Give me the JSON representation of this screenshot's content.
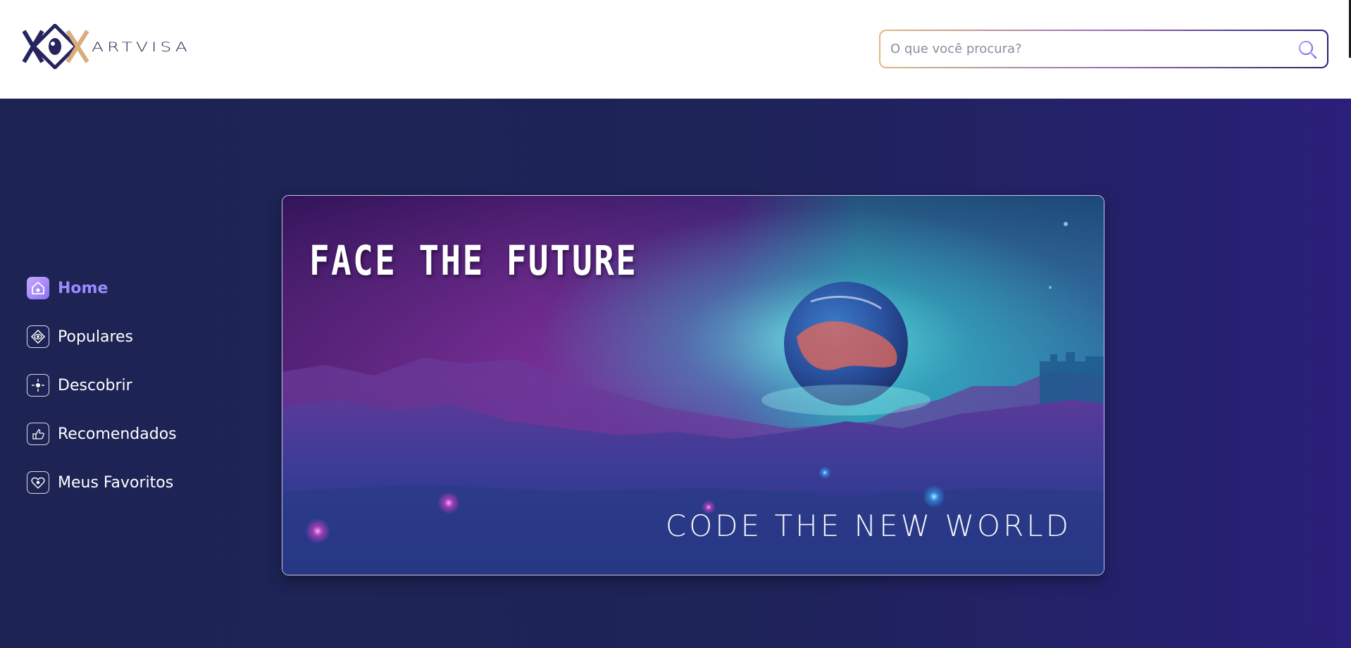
{
  "brand": {
    "name": "ARTVISA"
  },
  "search": {
    "placeholder": "O que você procura?",
    "icon": "search-icon"
  },
  "sidebar": {
    "items": [
      {
        "label": "Home",
        "icon": "home-icon",
        "active": true
      },
      {
        "label": "Populares",
        "icon": "popular-diamond-icon",
        "active": false
      },
      {
        "label": "Descobrir",
        "icon": "discover-sparkle-icon",
        "active": false
      },
      {
        "label": "Recomendados",
        "icon": "recommend-hand-icon",
        "active": false
      },
      {
        "label": "Meus Favoritos",
        "icon": "favorites-heart-icon",
        "active": false
      }
    ]
  },
  "banner": {
    "title": "FACE THE FUTURE",
    "subtitle": "CODE THE NEW WORLD"
  },
  "colors": {
    "accent": "#9a8cff",
    "main_bg": "#1d2454",
    "header_bg": "#ffffff"
  }
}
